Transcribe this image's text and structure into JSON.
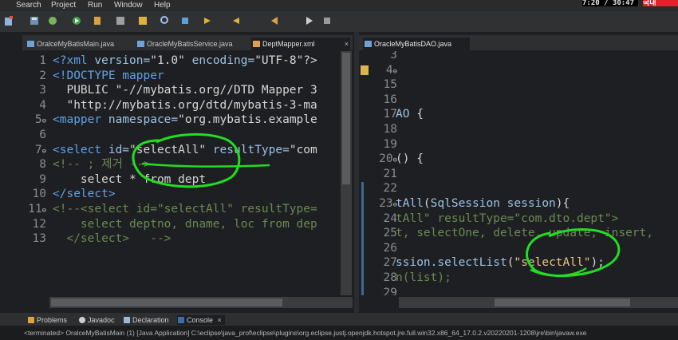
{
  "menu": {
    "items": [
      "Search",
      "Project",
      "Run",
      "Window",
      "Help"
    ]
  },
  "top_right": {
    "left_text": "7:20 / 30:47",
    "right_text": "국내"
  },
  "left_tabs": [
    {
      "label": "OralceMyBatisMain.java",
      "active": false
    },
    {
      "label": "OracleMyBatisService.java",
      "active": false
    },
    {
      "label": "DeptMapper.xml",
      "active": true
    }
  ],
  "right_tabs": [
    {
      "label": "OracleMyBatisDAO.java",
      "active": true
    }
  ],
  "left_editor": {
    "line_numbers": [
      "1",
      "2",
      "3",
      "4",
      "5",
      "6",
      "7",
      "8",
      "9",
      "10",
      "11",
      "12",
      "13"
    ],
    "fold_markers": {
      "5": "⊖",
      "7": "⊖",
      "11": "⊖"
    },
    "lines": [
      {
        "parts": [
          [
            "tag",
            "<?xml "
          ],
          [
            "attr",
            "version="
          ],
          [
            "str",
            "\"1.0\" "
          ],
          [
            "attr",
            "encoding="
          ],
          [
            "str",
            "\"UTF-8\"?>"
          ]
        ]
      },
      {
        "parts": [
          [
            "tag",
            "<!DOCTYPE mapper"
          ]
        ]
      },
      {
        "parts": [
          [
            "txt",
            "  PUBLIC \"-//mybatis.org//DTD Mapper 3"
          ]
        ]
      },
      {
        "parts": [
          [
            "txt",
            "  \"http://mybatis.org/dtd/mybatis-3-ma"
          ]
        ]
      },
      {
        "parts": [
          [
            "tag",
            "<mapper "
          ],
          [
            "attr",
            "namespace="
          ],
          [
            "str",
            "\"org.mybatis.example"
          ]
        ]
      },
      {
        "parts": []
      },
      {
        "parts": [
          [
            "tag",
            "<select "
          ],
          [
            "attr",
            "id="
          ],
          [
            "str",
            "\"selectAll\" "
          ],
          [
            "attr",
            "resultType="
          ],
          [
            "str",
            "\"com"
          ]
        ]
      },
      {
        "parts": [
          [
            "com",
            "<!-- ; 제거 -->"
          ]
        ]
      },
      {
        "parts": [
          [
            "txt",
            "    select * from dept"
          ]
        ]
      },
      {
        "parts": [
          [
            "tag",
            "</select>"
          ]
        ]
      },
      {
        "parts": [
          [
            "com",
            "<!--<select id=\"selectAll\" resultType="
          ]
        ]
      },
      {
        "parts": [
          [
            "com",
            "    select deptno, dname, loc from dep"
          ]
        ]
      },
      {
        "parts": [
          [
            "com",
            "  </select>   -->"
          ]
        ]
      }
    ]
  },
  "right_editor": {
    "line_numbers": [
      "3",
      "4",
      "15",
      "16",
      "17",
      "18",
      "19",
      "20",
      "21",
      "22",
      "23",
      "24",
      "25",
      "26",
      "27",
      "28",
      "29"
    ],
    "fold_markers": {
      "4": "⊖",
      "20": "⊖",
      "23": "⊖"
    },
    "lines": [
      {
        "parts": []
      },
      {
        "parts": [
          [
            "txt",
            ""
          ]
        ]
      },
      {
        "parts": []
      },
      {
        "parts": []
      },
      {
        "parts": [
          [
            "id",
            "AO "
          ],
          [
            "txt",
            "{"
          ]
        ]
      },
      {
        "parts": []
      },
      {
        "parts": []
      },
      {
        "parts": [
          [
            "txt",
            "() {"
          ]
        ]
      },
      {
        "parts": []
      },
      {
        "parts": []
      },
      {
        "parts": [
          [
            "id",
            "tAll"
          ],
          [
            "txt",
            "("
          ],
          [
            "id",
            "SqlSession session"
          ],
          [
            "txt",
            ")"
          ],
          [
            "txt",
            "{"
          ]
        ]
      },
      {
        "parts": [
          [
            "com",
            "tAll\" resultType=\"com.dto.dept\">"
          ]
        ]
      },
      {
        "parts": [
          [
            "com",
            "t, selectOne, delete, update, insert,"
          ]
        ]
      },
      {
        "parts": []
      },
      {
        "parts": [
          [
            "id",
            "ssion.selectList"
          ],
          [
            "txt",
            "("
          ],
          [
            "val",
            "\"selectAll\""
          ],
          [
            "txt",
            ");"
          ]
        ]
      },
      {
        "parts": [
          [
            "com",
            "n(list);"
          ]
        ]
      },
      {
        "parts": []
      }
    ]
  },
  "bottom_tabs": [
    {
      "label": "Problems",
      "icon": "problems-icon",
      "active": false
    },
    {
      "label": "Javadoc",
      "icon": "javadoc-icon",
      "active": false
    },
    {
      "label": "Declaration",
      "icon": "declaration-icon",
      "active": false
    },
    {
      "label": "Console",
      "icon": "console-icon",
      "active": true
    }
  ],
  "console_status": "<terminated> OralceMyBatisMain (1) [Java Application] C:\\eclipse\\java_prof\\eclipse\\plugins\\org.eclipse.justj.openjdk.hotspot.jre.full.win32.x86_64_17.0.2.v20220201-1208\\jre\\bin\\javaw.exe",
  "colors": {
    "accent": "#4ea1ff",
    "ink_annotation": "#22dd22",
    "tag": "#5ea2e5",
    "comment": "#6a8a52",
    "string": "#d6d6d6"
  }
}
